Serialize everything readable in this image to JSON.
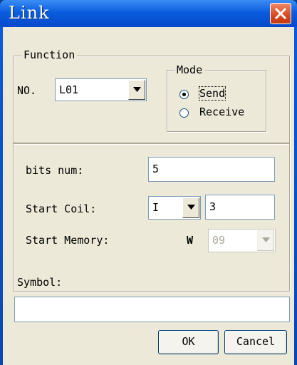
{
  "window": {
    "title": "Link"
  },
  "function_group": {
    "legend": "Function",
    "no_label": "NO.",
    "no_value": "L01",
    "mode": {
      "legend": "Mode",
      "options": [
        {
          "label": "Send",
          "selected": true
        },
        {
          "label": "Receive",
          "selected": false
        }
      ]
    }
  },
  "params": {
    "bits_num_label": "bits num:",
    "bits_num_value": "5",
    "start_coil_label": "Start Coil:",
    "start_coil_type": "I",
    "start_coil_value": "3",
    "start_memory_label": "Start Memory:",
    "start_memory_type": "W",
    "start_memory_value": "09"
  },
  "symbol": {
    "label": "Symbol:",
    "value": ""
  },
  "buttons": {
    "ok": "OK",
    "cancel": "Cancel"
  },
  "colors": {
    "titlebar": "#0a5ddf",
    "dialog_bg": "#ece9d8",
    "close_red": "#d8481d"
  },
  "icons": {
    "close": "close-x-icon",
    "dropdown": "dropdown-arrow-icon"
  }
}
